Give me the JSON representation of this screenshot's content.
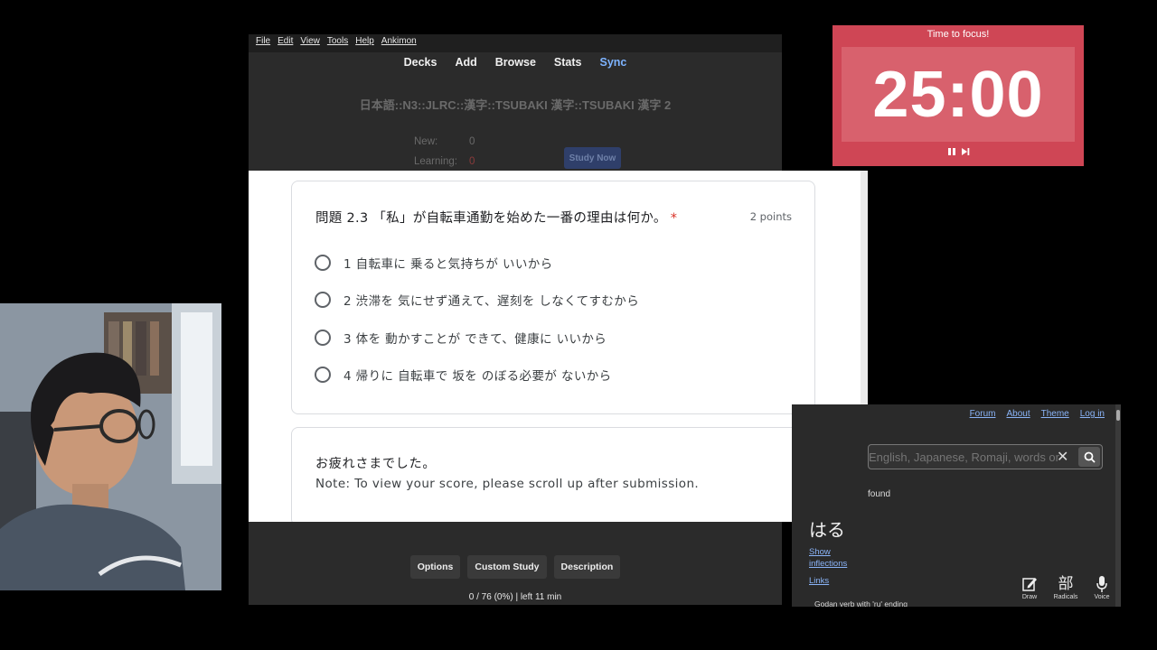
{
  "anki": {
    "menu": [
      "File",
      "Edit",
      "View",
      "Tools",
      "Help",
      "Ankimon"
    ],
    "toolbar": {
      "decks": "Decks",
      "add": "Add",
      "browse": "Browse",
      "stats": "Stats",
      "sync": "Sync"
    },
    "deck_title": "日本語::N3::JLRC::漢字::TSUBAKI 漢字::TSUBAKI 漢字 2",
    "stats": {
      "new_label": "New:",
      "new_value": "0",
      "learning_label": "Learning:",
      "learning_value": "0"
    },
    "study_now": "Study Now",
    "bottom_buttons": {
      "options": "Options",
      "custom_study": "Custom Study",
      "description": "Description"
    },
    "progress": "0 / 76 (0%) | left 11 min"
  },
  "quiz": {
    "question": "問題 2.3 「私」が自転車通勤を始めた一番の理由は何か。",
    "required_mark": "*",
    "points": "2 points",
    "options": [
      "1 自転車に 乗ると気持ちが いいから",
      "2 渋滞を 気にせず通えて、遅刻を しなくてすむから",
      "3 体を 動かすことが できて、健康に いいから",
      "4 帰りに 自転車で 坂を のぼる必要が ないから"
    ],
    "message_line1": "お疲れさまでした。",
    "message_line2": "Note: To view your score, please scroll up after submission.",
    "scroll_top_icon": "chevron-up-icon"
  },
  "timer": {
    "label": "Time to focus!",
    "time": "25:00",
    "bg_color": "#cf4655",
    "controls": [
      "pause-icon",
      "skip-next-icon"
    ]
  },
  "dictionary": {
    "nav": {
      "forum": "Forum",
      "about": "About",
      "theme": "Theme",
      "login": "Log in"
    },
    "search_placeholder": "English, Japanese, Romaji, words or",
    "found_text": "found",
    "word": "はる",
    "show_inflections": [
      "Show",
      "inflections"
    ],
    "links": "Links",
    "pos": "Godan verb with 'ru' ending",
    "tools": {
      "draw": "Draw",
      "radicals": "Radicals",
      "voice": "Voice",
      "radicals_glyph": "部"
    }
  }
}
